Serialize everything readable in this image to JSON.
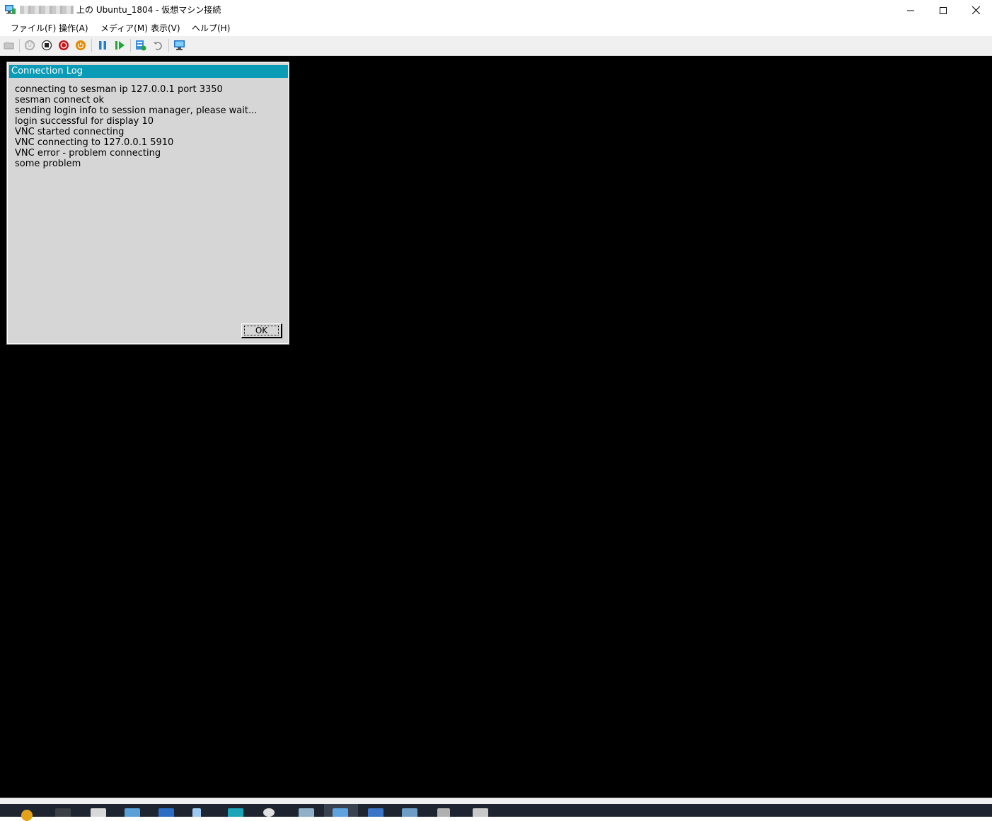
{
  "window": {
    "title_suffix": "上の Ubuntu_1804 - 仮想マシン接続",
    "icon": "vm-connect-icon"
  },
  "menu": [
    "ファイル(F)",
    "操作(A)",
    "メディア(M)",
    "表示(V)",
    "ヘルプ(H)"
  ],
  "toolbar": {
    "icons": [
      "ctrl-alt-del-icon",
      "start-icon",
      "turn-off-icon",
      "shutdown-icon",
      "save-icon",
      "pause-icon",
      "resume-icon",
      "checkpoint-icon",
      "revert-icon",
      "enhanced-session-icon"
    ]
  },
  "dialog": {
    "title": "Connection Log",
    "lines": [
      "connecting to sesman ip 127.0.0.1 port 3350",
      "sesman connect ok",
      "sending login info to session manager, please wait...",
      "login successful for display 10",
      "VNC started connecting",
      "VNC connecting to 127.0.0.1 5910",
      "VNC error - problem connecting",
      "some problem"
    ],
    "ok_label": "OK"
  },
  "colors": {
    "dialog_title_bg": "#0a9bb7",
    "vm_background": "#000000",
    "taskbar_bg": "#1e2530"
  }
}
